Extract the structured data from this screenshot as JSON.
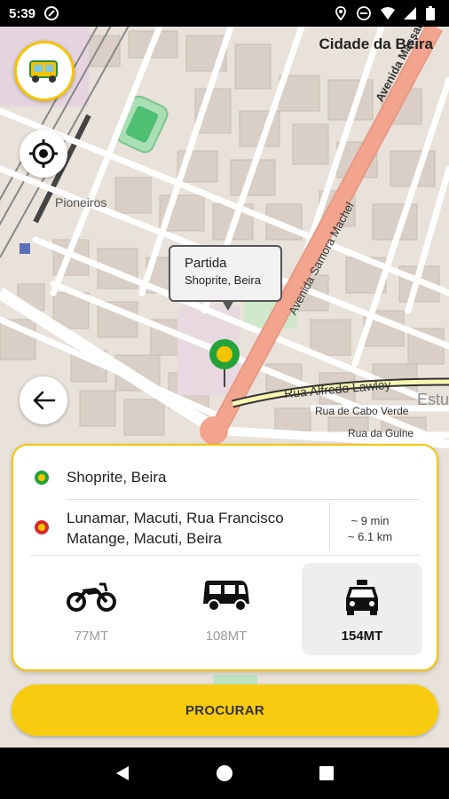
{
  "status_bar": {
    "time": "5:39"
  },
  "map": {
    "city": "Cidade da Beira",
    "places": {
      "pioneiros": "Pioneiros",
      "estu": "Estu"
    },
    "roads": {
      "massano": "Avenida Massano",
      "samora": "Avenida Samora Machel",
      "alfredo": "Rua Alfredo Lawley",
      "cabo_verde": "Rua de Cabo Verde",
      "guine": "Rua da Guine"
    },
    "tooltip": {
      "title": "Partida",
      "subtitle": "Shoprite, Beira"
    }
  },
  "trip": {
    "origin": "Shoprite, Beira",
    "destination": "Lunamar, Macuti, Rua Francisco Matange, Macuti, Beira",
    "duration": "~ 9 min",
    "distance": "~ 6.1 km"
  },
  "options": [
    {
      "name": "motorcycle",
      "price": "77MT",
      "selected": false
    },
    {
      "name": "tuk-tuk",
      "price": "108MT",
      "selected": false
    },
    {
      "name": "taxi",
      "price": "154MT",
      "selected": true
    }
  ],
  "actions": {
    "search": "PROCURAR"
  },
  "colors": {
    "accent": "#f9cb10",
    "origin": "#24a33a",
    "destination": "#d62b2b",
    "main_road": "#f2a48f"
  }
}
